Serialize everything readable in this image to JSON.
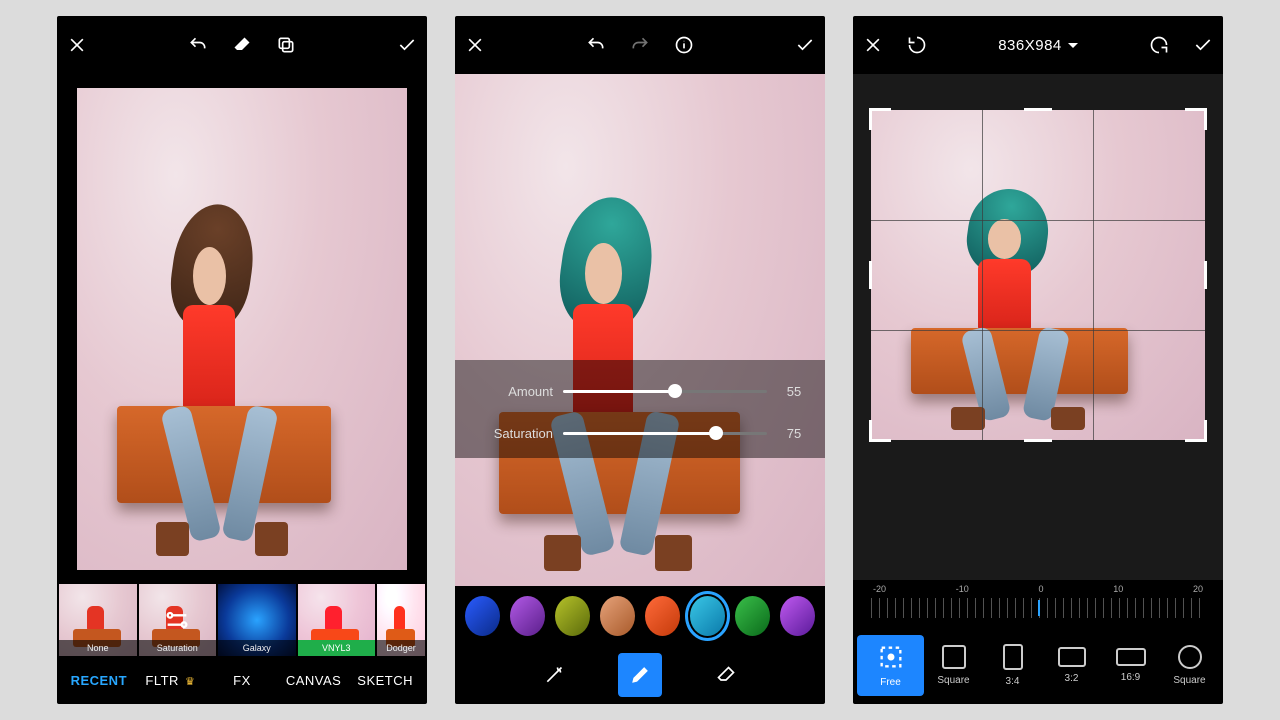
{
  "phone1": {
    "icons": {
      "close": "✕",
      "undo": "↶",
      "erase": "eraser",
      "layers": "layers",
      "confirm": "✓"
    },
    "effects": [
      {
        "name": "None",
        "style": "none"
      },
      {
        "name": "Saturation",
        "style": "saturation",
        "selected": true
      },
      {
        "name": "Galaxy",
        "style": "galaxy"
      },
      {
        "name": "VNYL3",
        "style": "vnyl",
        "vnyl": true
      },
      {
        "name": "Dodger",
        "style": "dodger",
        "partial": true
      }
    ],
    "tabs": [
      {
        "label": "RECENT",
        "active": true
      },
      {
        "label": "FLTR",
        "premium": true
      },
      {
        "label": "FX"
      },
      {
        "label": "CANVAS"
      },
      {
        "label": "SKETCH"
      }
    ]
  },
  "phone2": {
    "icons": {
      "close": "✕",
      "undo": "↶",
      "redo": "↷",
      "info": "ⓘ",
      "confirm": "✓"
    },
    "sliders": [
      {
        "label": "Amount",
        "value": 55,
        "max": 100
      },
      {
        "label": "Saturation",
        "value": 75,
        "max": 100
      }
    ],
    "swatches": [
      {
        "color": "linear-gradient(135deg,#2a5cff,#0a2a88)"
      },
      {
        "color": "linear-gradient(135deg,#b25ae6,#5a1e8a)"
      },
      {
        "color": "linear-gradient(135deg,#b6c22a,#5a6a0a)"
      },
      {
        "color": "linear-gradient(135deg,#e6a27a,#a85a2a)"
      },
      {
        "color": "linear-gradient(135deg,#ff6a3a,#c43a0a)"
      },
      {
        "color": "linear-gradient(135deg,#3ac6e6,#0a7aaa)",
        "selected": true
      },
      {
        "color": "linear-gradient(135deg,#3abf4a,#0a6a1a)"
      },
      {
        "color": "linear-gradient(135deg,#c05af0,#5a1a9a)"
      }
    ],
    "tools": [
      {
        "name": "magic-wand-icon"
      },
      {
        "name": "brush-icon",
        "active": true
      },
      {
        "name": "eraser-icon"
      }
    ]
  },
  "phone3": {
    "icons": {
      "close": "✕",
      "reset": "⟲",
      "redo": "↻",
      "confirm": "✓"
    },
    "dimensions": "836X984",
    "ruler_labels": [
      "-20",
      "-10",
      "0",
      "10",
      "20"
    ],
    "ratios": [
      {
        "label": "Free",
        "shape": "free",
        "selected": true
      },
      {
        "label": "Square",
        "shape": "sq"
      },
      {
        "label": "3:4",
        "shape": "r34"
      },
      {
        "label": "3:2",
        "shape": "r32"
      },
      {
        "label": "16:9",
        "shape": "r169"
      },
      {
        "label": "Square",
        "shape": "circle"
      }
    ]
  }
}
